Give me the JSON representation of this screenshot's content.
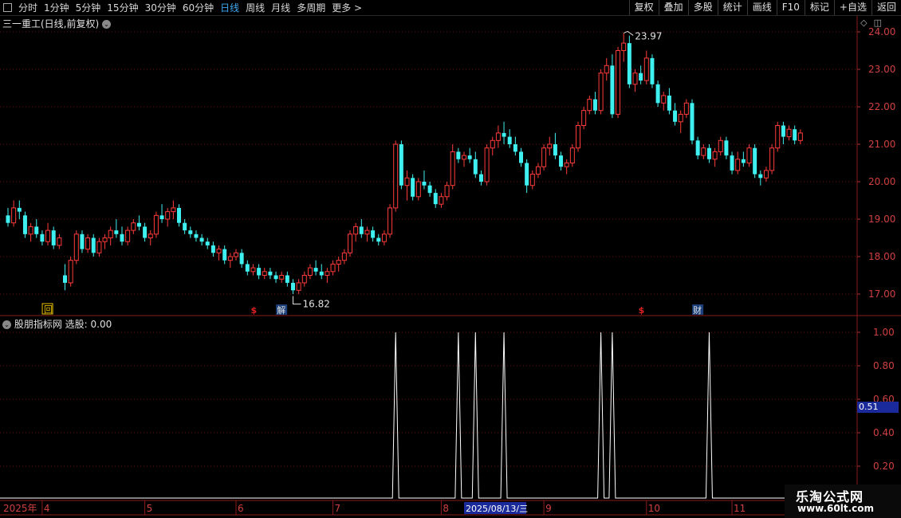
{
  "toolbar": {
    "left": [
      {
        "label": "分时",
        "active": false
      },
      {
        "label": "1分钟",
        "active": false
      },
      {
        "label": "5分钟",
        "active": false
      },
      {
        "label": "15分钟",
        "active": false
      },
      {
        "label": "30分钟",
        "active": false
      },
      {
        "label": "60分钟",
        "active": false
      },
      {
        "label": "日线",
        "active": true
      },
      {
        "label": "周线",
        "active": false
      },
      {
        "label": "月线",
        "active": false
      },
      {
        "label": "多周期",
        "active": false
      },
      {
        "label": "更多 >",
        "active": false
      }
    ],
    "right": [
      "复权",
      "叠加",
      "多股",
      "统计",
      "画线",
      "F10",
      "标记",
      "+自选",
      "返回"
    ]
  },
  "main_title": "三一重工(日线,前复权)",
  "indicator_title": "股朋指标网 选股: 0.00",
  "value_badge": "0.51",
  "watermark": {
    "line1": "乐淘公式网",
    "line2": "www.60lt.com"
  },
  "chart_data": [
    {
      "type": "candlestick",
      "ylim": [
        16.7,
        24.3
      ],
      "yticks": [
        "24.00",
        "23.00",
        "22.00",
        "21.00",
        "20.00",
        "19.00",
        "18.00",
        "17.00"
      ],
      "ohlc": [
        [
          19.1,
          19.3,
          18.8,
          18.9
        ],
        [
          18.9,
          19.5,
          18.8,
          19.3
        ],
        [
          19.3,
          19.5,
          19.0,
          19.2
        ],
        [
          19.1,
          19.2,
          18.5,
          18.6
        ],
        [
          18.6,
          18.9,
          18.4,
          18.8
        ],
        [
          18.8,
          19.0,
          18.5,
          18.6
        ],
        [
          18.6,
          18.7,
          18.3,
          18.4
        ],
        [
          18.4,
          18.9,
          18.3,
          18.7
        ],
        [
          18.7,
          18.8,
          18.2,
          18.3
        ],
        [
          18.3,
          18.6,
          18.2,
          18.5
        ],
        [
          17.5,
          17.8,
          17.1,
          17.3
        ],
        [
          17.3,
          18.0,
          17.2,
          17.9
        ],
        [
          17.9,
          18.7,
          17.8,
          18.6
        ],
        [
          18.6,
          18.7,
          18.1,
          18.2
        ],
        [
          18.2,
          18.6,
          18.1,
          18.5
        ],
        [
          18.5,
          18.6,
          18.0,
          18.1
        ],
        [
          18.1,
          18.5,
          18.0,
          18.4
        ],
        [
          18.4,
          18.6,
          18.2,
          18.5
        ],
        [
          18.5,
          18.8,
          18.3,
          18.7
        ],
        [
          18.7,
          19.0,
          18.5,
          18.6
        ],
        [
          18.6,
          18.8,
          18.3,
          18.4
        ],
        [
          18.4,
          18.8,
          18.3,
          18.7
        ],
        [
          18.7,
          19.0,
          18.6,
          18.9
        ],
        [
          18.9,
          19.1,
          18.7,
          18.8
        ],
        [
          18.8,
          18.9,
          18.4,
          18.5
        ],
        [
          18.5,
          18.7,
          18.3,
          18.6
        ],
        [
          18.6,
          19.2,
          18.5,
          19.1
        ],
        [
          19.1,
          19.4,
          18.9,
          19.0
        ],
        [
          19.0,
          19.3,
          18.8,
          19.2
        ],
        [
          19.2,
          19.5,
          19.0,
          19.3
        ],
        [
          19.3,
          19.4,
          18.8,
          18.9
        ],
        [
          18.9,
          19.0,
          18.6,
          18.7
        ],
        [
          18.7,
          18.8,
          18.5,
          18.6
        ],
        [
          18.6,
          18.7,
          18.4,
          18.5
        ],
        [
          18.5,
          18.6,
          18.3,
          18.4
        ],
        [
          18.4,
          18.5,
          18.2,
          18.3
        ],
        [
          18.3,
          18.4,
          18.0,
          18.1
        ],
        [
          18.1,
          18.3,
          17.9,
          18.2
        ],
        [
          18.2,
          18.3,
          17.8,
          17.9
        ],
        [
          17.9,
          18.1,
          17.7,
          18.0
        ],
        [
          18.0,
          18.2,
          17.9,
          18.1
        ],
        [
          18.1,
          18.2,
          17.7,
          17.8
        ],
        [
          17.8,
          17.9,
          17.5,
          17.6
        ],
        [
          17.6,
          17.8,
          17.5,
          17.7
        ],
        [
          17.7,
          17.8,
          17.4,
          17.5
        ],
        [
          17.5,
          17.7,
          17.4,
          17.6
        ],
        [
          17.6,
          17.7,
          17.4,
          17.5
        ],
        [
          17.5,
          17.6,
          17.3,
          17.4
        ],
        [
          17.4,
          17.6,
          17.3,
          17.5
        ],
        [
          17.5,
          17.6,
          17.2,
          17.3
        ],
        [
          17.3,
          17.4,
          17.0,
          17.1
        ],
        [
          17.1,
          17.4,
          17.0,
          17.3
        ],
        [
          17.3,
          17.6,
          17.2,
          17.5
        ],
        [
          17.5,
          17.8,
          17.4,
          17.7
        ],
        [
          17.7,
          17.9,
          17.5,
          17.6
        ],
        [
          17.6,
          17.8,
          17.4,
          17.5
        ],
        [
          17.5,
          17.7,
          17.3,
          17.6
        ],
        [
          17.6,
          17.9,
          17.5,
          17.8
        ],
        [
          17.8,
          18.0,
          17.6,
          17.9
        ],
        [
          17.9,
          18.2,
          17.8,
          18.1
        ],
        [
          18.1,
          18.7,
          18.0,
          18.6
        ],
        [
          18.6,
          18.9,
          18.4,
          18.8
        ],
        [
          18.8,
          19.0,
          18.5,
          18.6
        ],
        [
          18.6,
          18.8,
          18.4,
          18.7
        ],
        [
          18.7,
          18.8,
          18.4,
          18.5
        ],
        [
          18.5,
          18.6,
          18.3,
          18.4
        ],
        [
          18.4,
          18.7,
          18.3,
          18.6
        ],
        [
          18.6,
          19.4,
          18.5,
          19.3
        ],
        [
          19.3,
          21.1,
          19.2,
          21.0
        ],
        [
          21.0,
          21.1,
          19.8,
          19.9
        ],
        [
          19.9,
          20.3,
          19.5,
          20.1
        ],
        [
          20.1,
          20.2,
          19.5,
          19.6
        ],
        [
          19.6,
          20.1,
          19.5,
          20.0
        ],
        [
          20.0,
          20.3,
          19.8,
          19.9
        ],
        [
          19.9,
          20.0,
          19.6,
          19.7
        ],
        [
          19.7,
          19.8,
          19.3,
          19.4
        ],
        [
          19.4,
          19.7,
          19.3,
          19.6
        ],
        [
          19.6,
          20.0,
          19.5,
          19.9
        ],
        [
          19.9,
          21.0,
          19.8,
          20.8
        ],
        [
          20.8,
          20.9,
          20.5,
          20.6
        ],
        [
          20.6,
          20.8,
          20.4,
          20.7
        ],
        [
          20.7,
          20.9,
          20.5,
          20.6
        ],
        [
          20.6,
          20.8,
          20.1,
          20.2
        ],
        [
          20.2,
          20.3,
          19.9,
          20.0
        ],
        [
          20.0,
          21.0,
          19.9,
          20.9
        ],
        [
          20.9,
          21.2,
          20.7,
          21.1
        ],
        [
          21.1,
          21.5,
          20.9,
          21.3
        ],
        [
          21.3,
          21.6,
          21.0,
          21.2
        ],
        [
          21.2,
          21.4,
          20.9,
          21.0
        ],
        [
          21.0,
          21.2,
          20.7,
          20.8
        ],
        [
          20.8,
          20.9,
          20.4,
          20.5
        ],
        [
          20.5,
          20.6,
          19.7,
          19.9
        ],
        [
          19.9,
          20.3,
          19.8,
          20.2
        ],
        [
          20.2,
          20.5,
          20.1,
          20.4
        ],
        [
          20.4,
          21.0,
          20.3,
          20.9
        ],
        [
          20.9,
          21.2,
          20.7,
          21.0
        ],
        [
          21.0,
          21.3,
          20.6,
          20.7
        ],
        [
          20.7,
          20.8,
          20.3,
          20.4
        ],
        [
          20.4,
          20.6,
          20.2,
          20.5
        ],
        [
          20.5,
          21.0,
          20.4,
          20.9
        ],
        [
          20.9,
          21.6,
          20.8,
          21.5
        ],
        [
          21.5,
          22.0,
          21.4,
          21.9
        ],
        [
          21.9,
          22.3,
          21.8,
          22.2
        ],
        [
          22.2,
          22.4,
          21.8,
          21.9
        ],
        [
          21.9,
          23.0,
          21.8,
          22.9
        ],
        [
          22.9,
          23.3,
          22.7,
          23.1
        ],
        [
          23.1,
          23.4,
          21.7,
          21.8
        ],
        [
          21.8,
          23.6,
          21.7,
          23.5
        ],
        [
          23.5,
          23.97,
          23.2,
          23.7
        ],
        [
          23.7,
          23.9,
          22.5,
          22.6
        ],
        [
          22.6,
          23.0,
          22.4,
          22.9
        ],
        [
          22.9,
          23.1,
          22.6,
          22.7
        ],
        [
          22.7,
          23.5,
          22.6,
          23.3
        ],
        [
          23.3,
          23.4,
          22.5,
          22.6
        ],
        [
          22.6,
          22.7,
          22.0,
          22.1
        ],
        [
          22.1,
          22.4,
          21.9,
          22.3
        ],
        [
          22.3,
          22.5,
          21.8,
          21.9
        ],
        [
          21.9,
          22.1,
          21.5,
          21.6
        ],
        [
          21.6,
          21.9,
          21.3,
          21.8
        ],
        [
          21.8,
          22.2,
          21.7,
          22.1
        ],
        [
          22.1,
          22.2,
          21.0,
          21.1
        ],
        [
          21.1,
          21.2,
          20.6,
          20.7
        ],
        [
          20.7,
          21.0,
          20.6,
          20.9
        ],
        [
          20.9,
          21.0,
          20.5,
          20.6
        ],
        [
          20.6,
          20.9,
          20.4,
          20.8
        ],
        [
          20.8,
          21.2,
          20.7,
          21.1
        ],
        [
          21.1,
          21.2,
          20.6,
          20.7
        ],
        [
          20.7,
          20.8,
          20.2,
          20.3
        ],
        [
          20.3,
          20.8,
          20.2,
          20.6
        ],
        [
          20.6,
          20.8,
          20.4,
          20.5
        ],
        [
          20.5,
          21.0,
          20.4,
          20.9
        ],
        [
          20.9,
          21.0,
          20.1,
          20.2
        ],
        [
          20.2,
          20.3,
          19.9,
          20.1
        ],
        [
          20.1,
          20.4,
          20.0,
          20.3
        ],
        [
          20.3,
          21.0,
          20.2,
          20.9
        ],
        [
          20.9,
          21.6,
          20.8,
          21.5
        ],
        [
          21.5,
          21.6,
          21.0,
          21.2
        ],
        [
          21.2,
          21.5,
          21.1,
          21.4
        ],
        [
          21.4,
          21.5,
          21.0,
          21.1
        ],
        [
          21.1,
          21.4,
          21.0,
          21.3
        ]
      ],
      "high_label": "23.97",
      "low_label": "16.82",
      "event_markers": [
        {
          "label": "$",
          "color": "#e02020"
        },
        {
          "label": "解",
          "color": "#3fa9f5"
        },
        {
          "label": "$",
          "color": "#e02020"
        },
        {
          "label": "财",
          "color": "#3fa9f5"
        },
        {
          "label": "回",
          "color": "#e8c000"
        }
      ]
    },
    {
      "type": "line",
      "name": "选股",
      "ylim": [
        0.1,
        1.05
      ],
      "yticks": [
        "1.00",
        "0.80",
        "0.60",
        "0.40",
        "0.20"
      ],
      "signal_bars": [
        68,
        79,
        82,
        87,
        104,
        106,
        123
      ],
      "values_note": "0 except 1.00 at signal bars"
    }
  ],
  "x_axis": {
    "labels": [
      {
        "bar": 0,
        "label": "2025年"
      },
      {
        "bar": 6,
        "label": "4"
      },
      {
        "bar": 24,
        "label": "5"
      },
      {
        "bar": 40,
        "label": "6"
      },
      {
        "bar": 57,
        "label": "7"
      },
      {
        "bar": 76,
        "label": "8"
      },
      {
        "bar": 94,
        "label": "9"
      },
      {
        "bar": 112,
        "label": "10"
      },
      {
        "bar": 127,
        "label": "11"
      }
    ],
    "selected_date": "2025/08/13/三"
  }
}
